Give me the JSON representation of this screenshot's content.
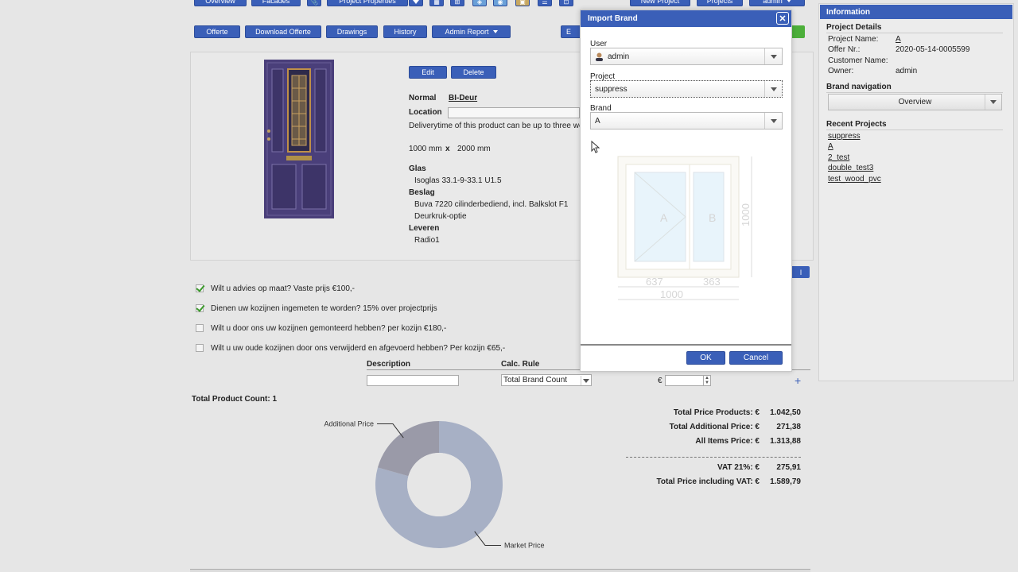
{
  "toolbar": {
    "overview": "Overview",
    "facades": "Facades",
    "project_properties": "Project Properties",
    "new_project": "New Project",
    "projects": "Projects",
    "admin": "admin"
  },
  "subbar": {
    "offerte": "Offerte",
    "download_offerte": "Download Offerte",
    "drawings": "Drawings",
    "history": "History",
    "admin_report": "Admin Report",
    "hidden_btn": "E"
  },
  "product": {
    "edit": "Edit",
    "delete": "Delete",
    "normal_label": "Normal",
    "normal_value": "BI-Deur",
    "location_label": "Location",
    "delivery_note": "Deliverytime of this product can be up to three we",
    "dimensions_w": "1000 mm",
    "dimensions_x": "x",
    "dimensions_h": "2000 mm",
    "glas_label": "Glas",
    "glas_value": "Isoglas 33.1-9-33.1 U1.5",
    "beslag_label": "Beslag",
    "beslag_value_1": "Buva 7220 cilinderbediend, incl. Balkslot F1",
    "beslag_value_2": "Deurkruk-optie",
    "leveren_label": "Leveren",
    "leveren_value": "Radio1"
  },
  "options": [
    {
      "label": "Wilt u advies op maat? Vaste prijs €100,-",
      "checked": true
    },
    {
      "label": "Dienen uw kozijnen ingemeten te worden? 15% over projectprijs",
      "checked": true
    },
    {
      "label": "Wilt u door ons uw kozijnen gemonteerd hebben? per kozijn €180,-",
      "checked": false
    },
    {
      "label": "Wilt u uw oude kozijnen door ons verwijderd en afgevoerd hebben? Per kozijn €65,-",
      "checked": false
    }
  ],
  "additional": {
    "description_header": "Description",
    "calc_rule_header": "Calc. Rule",
    "calc_rule_value": "Total Brand Count",
    "currency": "€",
    "add": "+"
  },
  "total_product_count": "Total Product Count: 1",
  "prices": {
    "total_products_label": "Total Price Products: €",
    "total_products_value": "1.042,50",
    "total_additional_label": "Total Additional Price: €",
    "total_additional_value": "271,38",
    "all_items_label": "All Items Price: €",
    "all_items_value": "1.313,88",
    "vat_label": "VAT 21%: €",
    "vat_value": "275,91",
    "total_incl_label": "Total Price including VAT: €",
    "total_incl_value": "1.589,79"
  },
  "chart_data": {
    "type": "pie",
    "variant": "donut",
    "categories": [
      "Market Price",
      "Additional Price"
    ],
    "values": [
      1042.5,
      271.38
    ],
    "colors": [
      "#a7b0c5",
      "#9a9aa8"
    ],
    "title": ""
  },
  "dialog": {
    "title": "Import Brand",
    "user_label": "User",
    "user_value": "admin",
    "project_label": "Project",
    "project_value": "suppress",
    "brand_label": "Brand",
    "brand_value": "A",
    "preview": {
      "sash_a": "A",
      "sash_b": "B",
      "width_a": "637",
      "width_b": "363",
      "total_width": "1000",
      "height": "1000"
    },
    "ok": "OK",
    "cancel": "Cancel"
  },
  "sidebar": {
    "title": "Information",
    "details_header": "Project Details",
    "project_name_label": "Project Name:",
    "project_name_value": "A",
    "offer_nr_label": "Offer Nr.:",
    "offer_nr_value": "2020-05-14-0005599",
    "customer_name_label": "Customer Name:",
    "customer_name_value": "",
    "owner_label": "Owner:",
    "owner_value": "admin",
    "brand_nav_header": "Brand navigation",
    "brand_nav_value": "Overview",
    "recent_header": "Recent Projects",
    "recent": [
      "suppress",
      "A",
      "2_test",
      "double_test3",
      "test_wood_pvc"
    ]
  },
  "colors": {
    "accent": "#3a5fb8",
    "door": "#4a3f7a",
    "green_button": "#4caf3a"
  }
}
